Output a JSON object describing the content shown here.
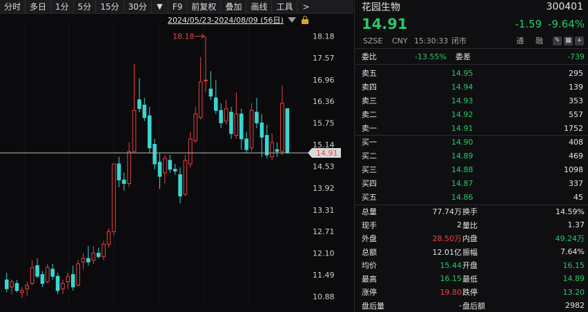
{
  "toolbar": {
    "periods": [
      "分时",
      "多日",
      "1分",
      "5分",
      "15分",
      "30分"
    ],
    "arrow": "▼",
    "buttons": [
      "F9",
      "前复权",
      "叠加",
      "画线",
      "工具"
    ],
    "more": ">"
  },
  "chart": {
    "date_range": "2024/05/23-2024/08/09 (56日)",
    "marker_high_label": "18.18",
    "price_tag": "14.91"
  },
  "chart_data": {
    "type": "candlestick",
    "ylim": [
      10.7,
      18.5
    ],
    "y_ticks": [
      "18.18",
      "17.57",
      "16.96",
      "16.36",
      "15.75",
      "15.14",
      "14.53",
      "13.92",
      "13.31",
      "12.71",
      "12.10",
      "11.49",
      "10.88"
    ],
    "last_price": 14.91,
    "high_marker": 18.18,
    "candles": [
      {
        "o": 11.35,
        "h": 11.55,
        "l": 11.0,
        "c": 11.1
      },
      {
        "o": 11.15,
        "h": 11.35,
        "l": 10.95,
        "c": 11.3
      },
      {
        "o": 11.25,
        "h": 11.35,
        "l": 11.0,
        "c": 11.05
      },
      {
        "o": 11.0,
        "h": 11.15,
        "l": 10.85,
        "c": 11.05
      },
      {
        "o": 11.1,
        "h": 11.3,
        "l": 10.9,
        "c": 11.2
      },
      {
        "o": 11.25,
        "h": 11.9,
        "l": 11.2,
        "c": 11.7
      },
      {
        "o": 11.75,
        "h": 11.95,
        "l": 11.4,
        "c": 11.45
      },
      {
        "o": 11.5,
        "h": 11.6,
        "l": 11.15,
        "c": 11.25
      },
      {
        "o": 11.3,
        "h": 11.8,
        "l": 11.25,
        "c": 11.7
      },
      {
        "o": 11.65,
        "h": 11.8,
        "l": 11.35,
        "c": 11.45
      },
      {
        "o": 11.45,
        "h": 11.55,
        "l": 10.95,
        "c": 11.05
      },
      {
        "o": 11.1,
        "h": 11.35,
        "l": 10.95,
        "c": 11.25
      },
      {
        "o": 11.3,
        "h": 11.55,
        "l": 11.1,
        "c": 11.45
      },
      {
        "o": 11.5,
        "h": 11.75,
        "l": 11.05,
        "c": 11.15
      },
      {
        "o": 11.2,
        "h": 11.9,
        "l": 11.15,
        "c": 11.8
      },
      {
        "o": 11.85,
        "h": 12.1,
        "l": 11.65,
        "c": 11.95
      },
      {
        "o": 11.95,
        "h": 12.3,
        "l": 11.75,
        "c": 11.85
      },
      {
        "o": 11.9,
        "h": 12.3,
        "l": 11.8,
        "c": 12.1
      },
      {
        "o": 12.1,
        "h": 12.25,
        "l": 11.95,
        "c": 12.0
      },
      {
        "o": 12.0,
        "h": 12.45,
        "l": 11.9,
        "c": 12.35
      },
      {
        "o": 12.35,
        "h": 12.8,
        "l": 12.25,
        "c": 12.7
      },
      {
        "o": 12.7,
        "h": 14.6,
        "l": 12.6,
        "c": 14.6
      },
      {
        "o": 14.6,
        "h": 14.8,
        "l": 13.95,
        "c": 14.15
      },
      {
        "o": 14.15,
        "h": 14.35,
        "l": 13.85,
        "c": 14.05
      },
      {
        "o": 14.05,
        "h": 15.2,
        "l": 13.95,
        "c": 14.95
      },
      {
        "o": 14.95,
        "h": 17.4,
        "l": 14.9,
        "c": 16.1
      },
      {
        "o": 16.4,
        "h": 17.0,
        "l": 16.05,
        "c": 16.15
      },
      {
        "o": 16.25,
        "h": 16.45,
        "l": 15.8,
        "c": 15.9
      },
      {
        "o": 15.95,
        "h": 16.2,
        "l": 14.9,
        "c": 15.05
      },
      {
        "o": 15.15,
        "h": 15.3,
        "l": 14.45,
        "c": 14.6
      },
      {
        "o": 14.65,
        "h": 14.9,
        "l": 13.9,
        "c": 14.25
      },
      {
        "o": 14.35,
        "h": 14.85,
        "l": 14.05,
        "c": 14.75
      },
      {
        "o": 14.7,
        "h": 14.85,
        "l": 14.35,
        "c": 14.45
      },
      {
        "o": 14.45,
        "h": 14.6,
        "l": 14.3,
        "c": 14.4
      },
      {
        "o": 14.3,
        "h": 14.5,
        "l": 13.5,
        "c": 13.7
      },
      {
        "o": 13.75,
        "h": 14.85,
        "l": 13.7,
        "c": 14.7
      },
      {
        "o": 14.6,
        "h": 15.5,
        "l": 14.5,
        "c": 15.3
      },
      {
        "o": 15.25,
        "h": 16.2,
        "l": 15.2,
        "c": 16.0
      },
      {
        "o": 15.9,
        "h": 17.6,
        "l": 15.85,
        "c": 16.9
      },
      {
        "o": 16.95,
        "h": 18.18,
        "l": 16.6,
        "c": 16.95
      },
      {
        "o": 16.7,
        "h": 17.2,
        "l": 16.4,
        "c": 16.5
      },
      {
        "o": 16.45,
        "h": 16.95,
        "l": 16.0,
        "c": 16.1
      },
      {
        "o": 16.1,
        "h": 16.3,
        "l": 15.6,
        "c": 15.75
      },
      {
        "o": 15.8,
        "h": 16.4,
        "l": 15.7,
        "c": 16.15
      },
      {
        "o": 16.05,
        "h": 16.2,
        "l": 15.3,
        "c": 15.45
      },
      {
        "o": 15.4,
        "h": 16.6,
        "l": 15.3,
        "c": 16.0
      },
      {
        "o": 16.0,
        "h": 16.15,
        "l": 15.0,
        "c": 15.3
      },
      {
        "o": 15.3,
        "h": 15.5,
        "l": 14.9,
        "c": 15.0
      },
      {
        "o": 15.05,
        "h": 16.3,
        "l": 14.95,
        "c": 16.1
      },
      {
        "o": 16.05,
        "h": 16.45,
        "l": 15.6,
        "c": 15.75
      },
      {
        "o": 15.75,
        "h": 16.0,
        "l": 14.8,
        "c": 15.35
      },
      {
        "o": 15.4,
        "h": 15.7,
        "l": 14.75,
        "c": 14.85
      },
      {
        "o": 14.8,
        "h": 15.45,
        "l": 14.7,
        "c": 15.2
      },
      {
        "o": 15.0,
        "h": 15.2,
        "l": 14.8,
        "c": 14.95
      },
      {
        "o": 14.95,
        "h": 16.8,
        "l": 14.85,
        "c": 16.3
      },
      {
        "o": 16.15,
        "h": 16.15,
        "l": 14.89,
        "c": 14.91
      }
    ]
  },
  "panel": {
    "name": "花园生物",
    "code": "300401",
    "price": "14.91",
    "change": "-1.59",
    "change_pct": "-9.64%",
    "exchange": "SZSE",
    "currency": "CNY",
    "time": "15:30:33",
    "market_status": "闭市",
    "tong": "通",
    "rong": "融",
    "weibi_label": "委比",
    "weibi_value": "-13.55%",
    "weicha_label": "委差",
    "weicha_value": "-739",
    "asks": [
      {
        "label": "卖五",
        "price": "14.95",
        "vol": "295"
      },
      {
        "label": "卖四",
        "price": "14.94",
        "vol": "139"
      },
      {
        "label": "卖三",
        "price": "14.93",
        "vol": "353"
      },
      {
        "label": "卖二",
        "price": "14.92",
        "vol": "557"
      },
      {
        "label": "卖一",
        "price": "14.91",
        "vol": "1752"
      }
    ],
    "bids": [
      {
        "label": "买一",
        "price": "14.90",
        "vol": "408"
      },
      {
        "label": "买二",
        "price": "14.89",
        "vol": "469"
      },
      {
        "label": "买三",
        "price": "14.88",
        "vol": "1098"
      },
      {
        "label": "买四",
        "price": "14.87",
        "vol": "337"
      },
      {
        "label": "买五",
        "price": "14.86",
        "vol": "45"
      }
    ],
    "stats": [
      {
        "l1": "总量",
        "v1": "77.74万",
        "l2": "换手",
        "v2": "14.59%",
        "c1": "white",
        "c2": "white"
      },
      {
        "l1": "现手",
        "v1": "2",
        "l2": "量比",
        "v2": "1.37",
        "c1": "white",
        "c2": "white"
      },
      {
        "l1": "外盘",
        "v1": "28.50万",
        "l2": "内盘",
        "v2": "49.24万",
        "c1": "red",
        "c2": "green"
      },
      {
        "l1": "总额",
        "v1": "12.01亿",
        "l2": "振幅",
        "v2": "7.64%",
        "c1": "white",
        "c2": "white"
      },
      {
        "l1": "均价",
        "v1": "15.44",
        "l2": "开盘",
        "v2": "16.15",
        "c1": "green",
        "c2": "green"
      },
      {
        "l1": "最高",
        "v1": "16.15",
        "l2": "最低",
        "v2": "14.89",
        "c1": "green",
        "c2": "green"
      },
      {
        "l1": "涨停",
        "v1": "19.80",
        "l2": "跌停",
        "v2": "13.20",
        "c1": "red",
        "c2": "green"
      },
      {
        "l1": "盘后量",
        "v1": "-",
        "l2": "盘后额",
        "v2": "2982",
        "c1": "white",
        "c2": "white"
      }
    ],
    "colors": {
      "up": "#f0413f",
      "down": "#27c86a",
      "cyan": "#3ad6d0"
    }
  }
}
